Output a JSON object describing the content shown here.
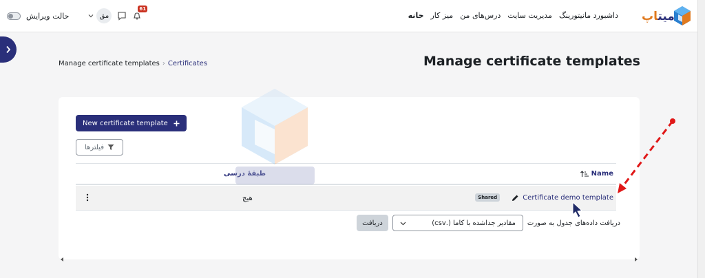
{
  "navbar": {
    "logo_text": "میت",
    "logo_text_accent": "اپ",
    "menu": [
      {
        "label": "خانه",
        "active": true
      },
      {
        "label": "میز کار",
        "active": false
      },
      {
        "label": "درس‌های من",
        "active": false
      },
      {
        "label": "مدیریت سایت",
        "active": false
      },
      {
        "label": "داشبورد مانیتورینگ",
        "active": false
      }
    ],
    "notification_count": "61",
    "user_initials": "مق",
    "edit_mode_label": "حالت ویرایش"
  },
  "page": {
    "title": "Manage certificate templates",
    "breadcrumb": [
      "Manage certificate templates",
      "Certificates"
    ]
  },
  "actions": {
    "new_template_label": "New certificate template",
    "filters_label": "فیلترها"
  },
  "table": {
    "columns": {
      "name": "Name",
      "category": "طبقهٔ درسی"
    },
    "rows": [
      {
        "name": "Certificate demo template",
        "badge": "Shared",
        "category": "هیچ"
      }
    ]
  },
  "download": {
    "label": "دریافت داده‌های جدول به صورت",
    "format_selected": "مقادیر جداشده با کاما (.csv)",
    "button_label": "دریافت"
  },
  "colors": {
    "primary": "#2a2f7a",
    "accent": "#e07a1f",
    "annotation": "#e01818"
  }
}
